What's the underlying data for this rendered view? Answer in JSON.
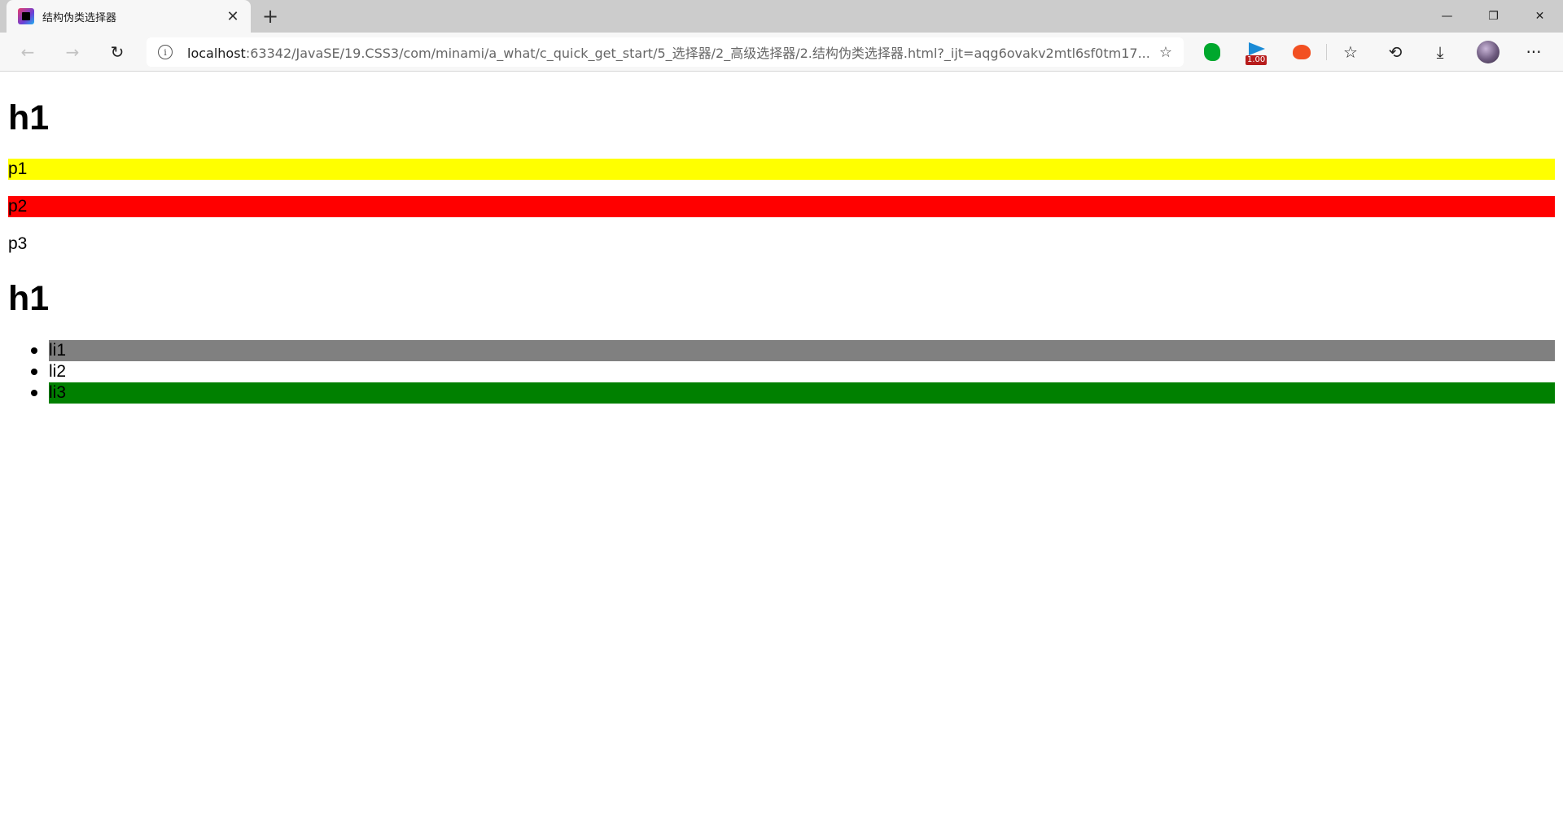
{
  "browser": {
    "tab": {
      "title": "结构伪类选择器",
      "close_glyph": "✕",
      "favicon": "intellij-favicon-icon"
    },
    "new_tab_glyph": "+",
    "window_controls": {
      "minimize": "—",
      "restore": "❐",
      "close": "✕"
    },
    "nav": {
      "back": "←",
      "forward": "→",
      "reload": "↻"
    },
    "address": {
      "host": "localhost",
      "rest": ":63342/JavaSE/19.CSS3/com/minami/a_what/c_quick_get_start/5_选择器/2_高级选择器/2.结构伪类选择器.html?_ijt=aqg6ovakv2mtl6sf0tm17..."
    },
    "extensions": {
      "player_badge": "1.00"
    },
    "toolbar_icons": {
      "favorites": "☆",
      "history": "⟲",
      "download": "⤓",
      "menu": "···"
    }
  },
  "page": {
    "h1_first": "h1",
    "paragraphs": [
      {
        "text": "p1",
        "background": "#ffff00"
      },
      {
        "text": "p2",
        "background": "#ff0000"
      },
      {
        "text": "p3",
        "background": "transparent"
      }
    ],
    "h1_second": "h1",
    "list_items": [
      {
        "text": "li1",
        "background": "#808080"
      },
      {
        "text": "li2",
        "background": "transparent"
      },
      {
        "text": "li3",
        "background": "#008000"
      }
    ]
  }
}
